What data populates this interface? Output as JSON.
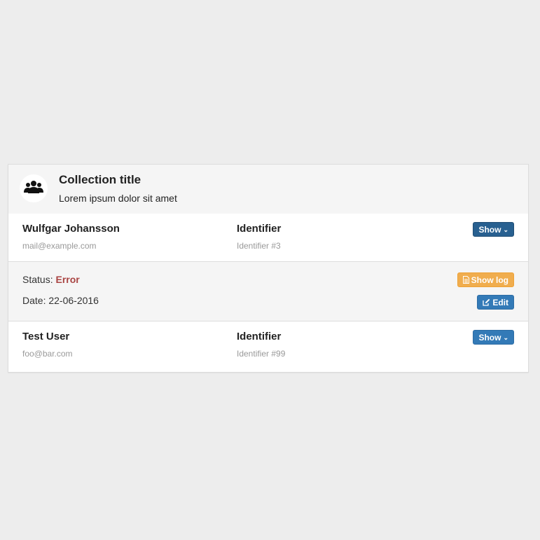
{
  "collection": {
    "title": "Collection title",
    "subtitle": "Lorem ipsum dolor sit amet",
    "icon": "users-icon"
  },
  "items": [
    {
      "name": "Wulfgar Johansson",
      "email": "mail@example.com",
      "identifier_label": "Identifier",
      "identifier_value": "Identifier #3",
      "show_label": "Show",
      "expanded": true
    },
    {
      "name": "Test User",
      "email": "foo@bar.com",
      "identifier_label": "Identifier",
      "identifier_value": "Identifier #99",
      "show_label": "Show",
      "expanded": false
    }
  ],
  "details": {
    "status_label": "Status:",
    "status_value": "Error",
    "date_text": "Date: 22-06-2016",
    "show_log_label": "Show log",
    "edit_label": "Edit"
  },
  "colors": {
    "primary": "#337ab7",
    "primary_active": "#286090",
    "warning": "#f0ad4e",
    "error": "#a94442"
  }
}
